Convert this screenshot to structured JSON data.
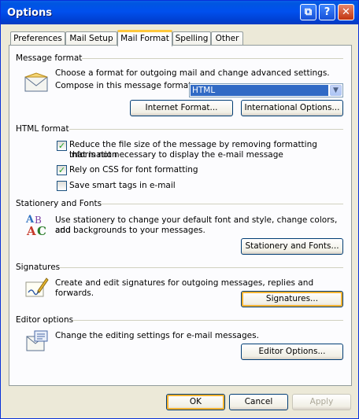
{
  "window": {
    "title": "Options",
    "help_glyph": "?",
    "close_glyph": "✕",
    "restore_glyph": "⧉"
  },
  "tabs": [
    {
      "label": "Preferences"
    },
    {
      "label": "Mail Setup"
    },
    {
      "label": "Mail Format"
    },
    {
      "label": "Spelling"
    },
    {
      "label": "Other"
    }
  ],
  "active_tab": "Mail Format",
  "message_format": {
    "title": "Message format",
    "description": "Choose a format for outgoing mail and change advanced settings.",
    "compose_label": "Compose in this message format:",
    "compose_value": "HTML",
    "internet_format_button": "Internet Format...",
    "international_options_button": "International Options..."
  },
  "html_format": {
    "title": "HTML format",
    "reduce_size_label_1": "Reduce the file size of the message by removing formatting information",
    "reduce_size_label_2": "that is not necessary to display the e-mail message",
    "reduce_size_checked": true,
    "rely_css_label": "Rely on CSS for font formatting",
    "rely_css_checked": true,
    "smart_tags_label": "Save smart tags in e-mail",
    "smart_tags_checked": false,
    "check_glyph": "✓"
  },
  "stationery": {
    "title": "Stationery and Fonts",
    "description_1": "Use stationery to change your default font and style, change colors, and",
    "description_2": "add backgrounds to your messages.",
    "button": "Stationery and Fonts..."
  },
  "signatures": {
    "title": "Signatures",
    "description": "Create and edit signatures for outgoing messages, replies and forwards.",
    "button": "Signatures..."
  },
  "editor": {
    "title": "Editor options",
    "description": "Change the editing settings for e-mail messages.",
    "button": "Editor Options..."
  },
  "footer": {
    "ok": "OK",
    "cancel": "Cancel",
    "apply": "Apply"
  },
  "colors": {
    "titlebar": "#0054e3",
    "dialog_bg": "#ece9d8",
    "selection": "#316ac5",
    "tab_highlight": "#ffc83c"
  }
}
